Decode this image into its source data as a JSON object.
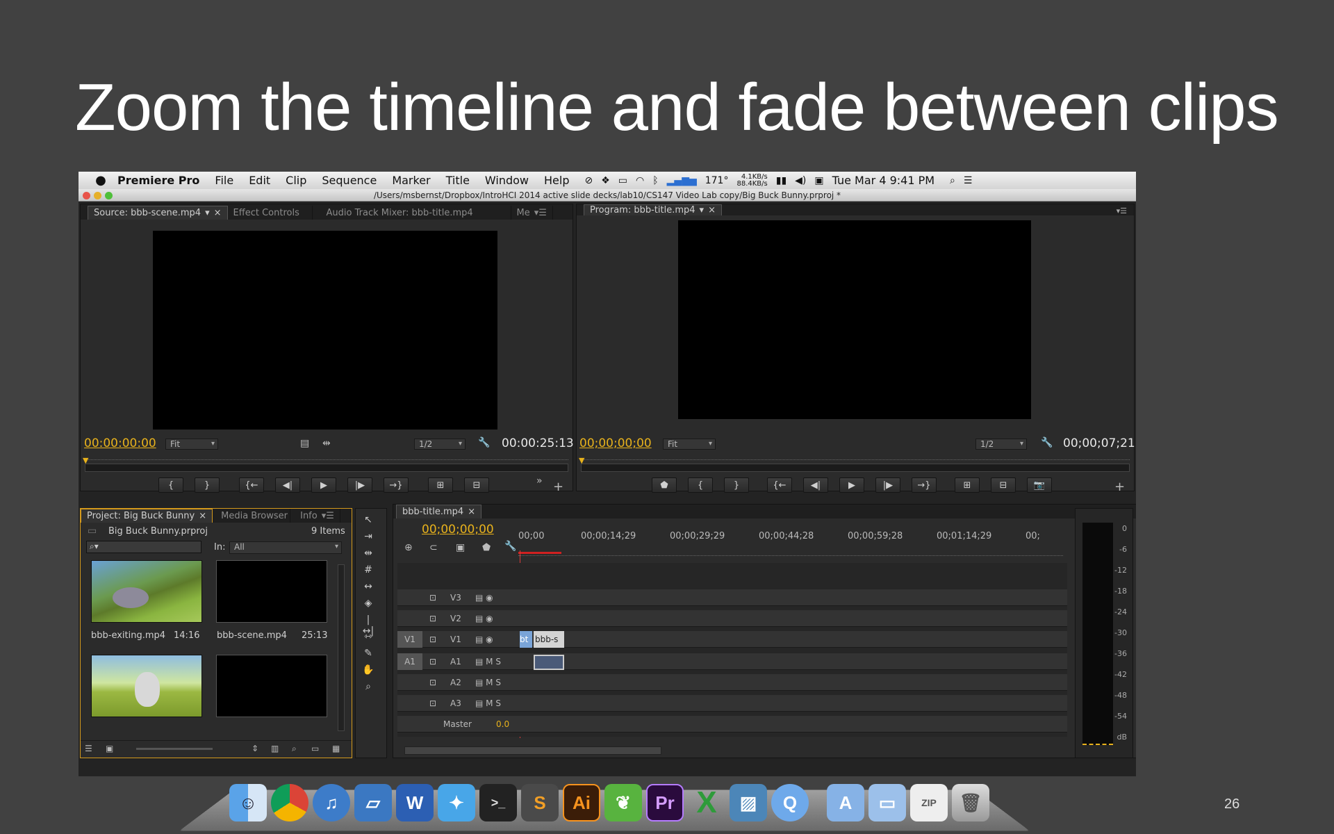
{
  "slide": {
    "title": "Zoom the timeline and fade between clips",
    "page_number": "26"
  },
  "menubar": {
    "app_name": "Premiere Pro",
    "items": [
      "File",
      "Edit",
      "Clip",
      "Sequence",
      "Marker",
      "Title",
      "Window",
      "Help"
    ],
    "status": {
      "temperature": "171°",
      "net_up": "4.1KB/s",
      "net_down": "88.4KB/s",
      "datetime": "Tue Mar 4  9:41 PM"
    }
  },
  "window": {
    "path": "/Users/msbernst/Dropbox/IntroHCI 2014 active slide decks/lab10/CS147 Video Lab copy/Big Buck Bunny.prproj *"
  },
  "source": {
    "tabs": [
      "Source: bbb-scene.mp4",
      "Effect Controls",
      "Audio Track Mixer: bbb-title.mp4",
      "Me"
    ],
    "timecode": "00:00:00:00",
    "fit": "Fit",
    "res": "1/2",
    "duration": "00:00:25:13"
  },
  "program": {
    "tab": "Program: bbb-title.mp4",
    "timecode": "00;00;00;00",
    "fit": "Fit",
    "res": "1/2",
    "duration": "00;00;07;21"
  },
  "project": {
    "tabs": [
      "Project: Big Buck Bunny",
      "Media Browser",
      "Info"
    ],
    "file": "Big Buck Bunny.prproj",
    "count": "9 Items",
    "in_label": "In:",
    "in_value": "All",
    "clips": [
      {
        "name": "bbb-exiting.mp4",
        "dur": "14:16"
      },
      {
        "name": "bbb-scene.mp4",
        "dur": "25:13"
      }
    ]
  },
  "timeline": {
    "tab": "bbb-title.mp4",
    "timecode": "00;00;00;00",
    "ruler": [
      "00;00",
      "00;00;14;29",
      "00;00;29;29",
      "00;00;44;28",
      "00;00;59;28",
      "00;01;14;29",
      "00;"
    ],
    "tracks_video": [
      "V3",
      "V2",
      "V1"
    ],
    "tracks_audio": [
      "A1",
      "A2",
      "A3"
    ],
    "master": "Master",
    "master_value": "0.0",
    "src_v": "V1",
    "src_a": "A1",
    "clip_label": "bbb-s",
    "clip_short": "bt"
  },
  "meter": {
    "labels": [
      "0",
      "-6",
      "-12",
      "-18",
      "-24",
      "-30",
      "-36",
      "-42",
      "-48",
      "-54",
      "dB"
    ]
  },
  "colors": {
    "timecode": "#e8b21c",
    "panel": "#2b2b2b",
    "accent": "#d59a1c"
  }
}
